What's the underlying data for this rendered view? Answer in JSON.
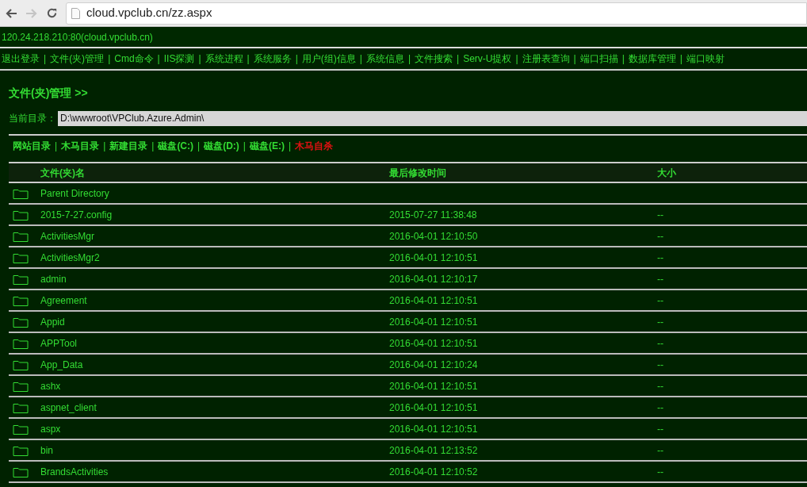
{
  "browser": {
    "url": "cloud.vpclub.cn/zz.aspx",
    "forward_disabled": true
  },
  "host": "120.24.218.210:80(cloud.vpclub.cn)",
  "nav": {
    "separator": "|",
    "items": [
      "退出登录",
      "文件(夹)管理",
      "Cmd命令",
      "IIS探测",
      "系统进程",
      "系统服务",
      "用户(组)信息",
      "系统信息",
      "文件搜索",
      "Serv-U提权",
      "注册表查询",
      "端口扫描",
      "数据库管理",
      "端口映射"
    ]
  },
  "section_title": "文件(夹)管理 >>",
  "current_dir": {
    "label": "当前目录：",
    "value": "D:\\wwwroot\\VPClub.Azure.Admin\\"
  },
  "links": {
    "separator": "|",
    "items": [
      {
        "label": "网站目录",
        "color": "#33dd33"
      },
      {
        "label": "木马目录",
        "color": "#33dd33"
      },
      {
        "label": "新建目录",
        "color": "#33dd33"
      },
      {
        "label": "磁盘(C:)",
        "color": "#33dd33"
      },
      {
        "label": "磁盘(D:)",
        "color": "#33dd33"
      },
      {
        "label": "磁盘(E:)",
        "color": "#33dd33"
      },
      {
        "label": "木马自杀",
        "color": "#dd1111"
      }
    ]
  },
  "table": {
    "columns": [
      "文件(夹)名",
      "最后修改时间",
      "大小"
    ],
    "rows": [
      {
        "name": "Parent Directory"
      },
      {
        "name": "2015-7-27.config",
        "modified": "2015-07-27 11:38:48",
        "size": "--"
      },
      {
        "name": "ActivitiesMgr",
        "modified": "2016-04-01 12:10:50",
        "size": "--"
      },
      {
        "name": "ActivitiesMgr2",
        "modified": "2016-04-01 12:10:51",
        "size": "--"
      },
      {
        "name": "admin",
        "modified": "2016-04-01 12:10:17",
        "size": "--"
      },
      {
        "name": "Agreement",
        "modified": "2016-04-01 12:10:51",
        "size": "--"
      },
      {
        "name": "Appid",
        "modified": "2016-04-01 12:10:51",
        "size": "--"
      },
      {
        "name": "APPTool",
        "modified": "2016-04-01 12:10:51",
        "size": "--"
      },
      {
        "name": "App_Data",
        "modified": "2016-04-01 12:10:24",
        "size": "--"
      },
      {
        "name": "ashx",
        "modified": "2016-04-01 12:10:51",
        "size": "--"
      },
      {
        "name": "aspnet_client",
        "modified": "2016-04-01 12:10:51",
        "size": "--"
      },
      {
        "name": "aspx",
        "modified": "2016-04-01 12:10:51",
        "size": "--"
      },
      {
        "name": "bin",
        "modified": "2016-04-01 12:13:52",
        "size": "--"
      },
      {
        "name": "BrandsActivities",
        "modified": "2016-04-01 12:10:52",
        "size": "--"
      }
    ]
  }
}
